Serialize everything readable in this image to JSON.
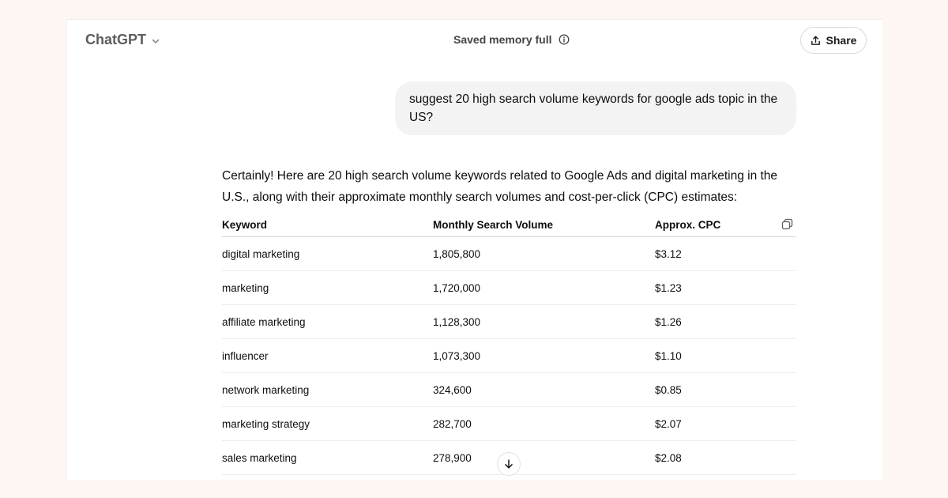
{
  "header": {
    "model_name": "ChatGPT",
    "memory_status": "Saved memory full",
    "share_label": "Share"
  },
  "conversation": {
    "user_message": "suggest 20 high search volume keywords for google ads topic in the US?",
    "assistant_intro": "Certainly! Here are 20 high search volume keywords related to Google Ads and digital marketing in the U.S., along with their approximate monthly search volumes and cost-per-click (CPC) estimates:"
  },
  "table": {
    "headers": [
      "Keyword",
      "Monthly Search Volume",
      "Approx. CPC"
    ],
    "rows": [
      [
        "digital marketing",
        "1,805,800",
        "$3.12"
      ],
      [
        "marketing",
        "1,720,000",
        "$1.23"
      ],
      [
        "affiliate marketing",
        "1,128,300",
        "$1.26"
      ],
      [
        "influencer",
        "1,073,300",
        "$1.10"
      ],
      [
        "network marketing",
        "324,600",
        "$0.85"
      ],
      [
        "marketing strategy",
        "282,700",
        "$2.07"
      ],
      [
        "sales marketing",
        "278,900",
        "$2.08"
      ]
    ]
  },
  "icons": {
    "model_chevron": "chevron-down-icon",
    "memory_info": "info-icon",
    "share": "share-icon",
    "copy_table": "copy-icon",
    "scroll": "arrow-down-icon"
  }
}
